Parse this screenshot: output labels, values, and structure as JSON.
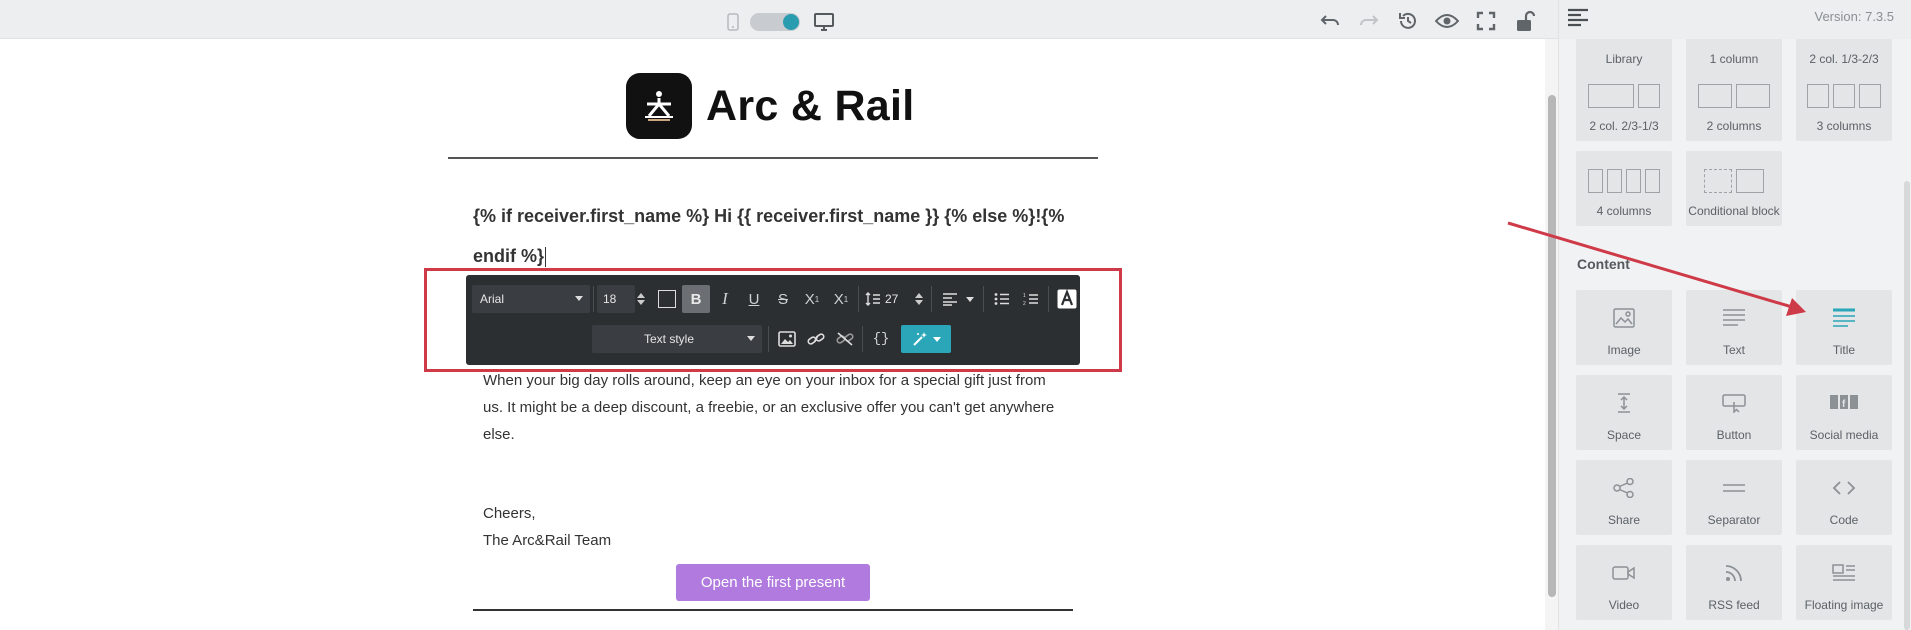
{
  "topbar": {
    "mobile_icon": "mobile-icon",
    "desktop_icon": "desktop-icon",
    "icons": [
      "undo-icon",
      "redo-icon",
      "history-icon",
      "preview-eye-icon",
      "fullscreen-icon",
      "unlock-icon"
    ]
  },
  "panel": {
    "version": "Version: 7.3.5",
    "layout_tiles": [
      "Library",
      "1 column",
      "2 col. 1/3-2/3",
      "2 col. 2/3-1/3",
      "2 columns",
      "3 columns",
      "4 columns",
      "Conditional block"
    ],
    "content_title": "Content",
    "content_tiles": [
      {
        "label": "Image",
        "icon": "image-icon"
      },
      {
        "label": "Text",
        "icon": "text-lines-icon"
      },
      {
        "label": "Title",
        "icon": "title-icon",
        "highlighted": true
      },
      {
        "label": "Space",
        "icon": "space-icon"
      },
      {
        "label": "Button",
        "icon": "button-icon"
      },
      {
        "label": "Social media",
        "icon": "social-media-icon"
      },
      {
        "label": "Share",
        "icon": "share-icon"
      },
      {
        "label": "Separator",
        "icon": "separator-icon"
      },
      {
        "label": "Code",
        "icon": "code-icon"
      },
      {
        "label": "Video",
        "icon": "video-icon"
      },
      {
        "label": "RSS feed",
        "icon": "rss-icon"
      },
      {
        "label": "Floating image",
        "icon": "floating-image-icon"
      }
    ]
  },
  "email": {
    "brand": "Arc & Rail",
    "greeting_line1": "{% if receiver.first_name %} Hi {{ receiver.first_name }} {% else %}!{%",
    "greeting_line2": "endif %}",
    "body_line1": "When your big day rolls around, keep an eye on your inbox for a special gift just from",
    "body_line2": "us. It might be a deep discount, a freebie, or an exclusive offer you can't get anywhere",
    "body_line3": "else.",
    "signoff_line1": "Cheers,",
    "signoff_line2": "The Arc&Rail Team",
    "cta_label": "Open the first present"
  },
  "format_toolbar": {
    "font": "Arial",
    "font_size": "18",
    "line_height": "27",
    "text_style": "Text style"
  },
  "colors": {
    "accent": "#2aa6b8",
    "cta": "#b07adf",
    "highlight": "#cf3a48",
    "toolbar_bg": "#2c2f32"
  }
}
